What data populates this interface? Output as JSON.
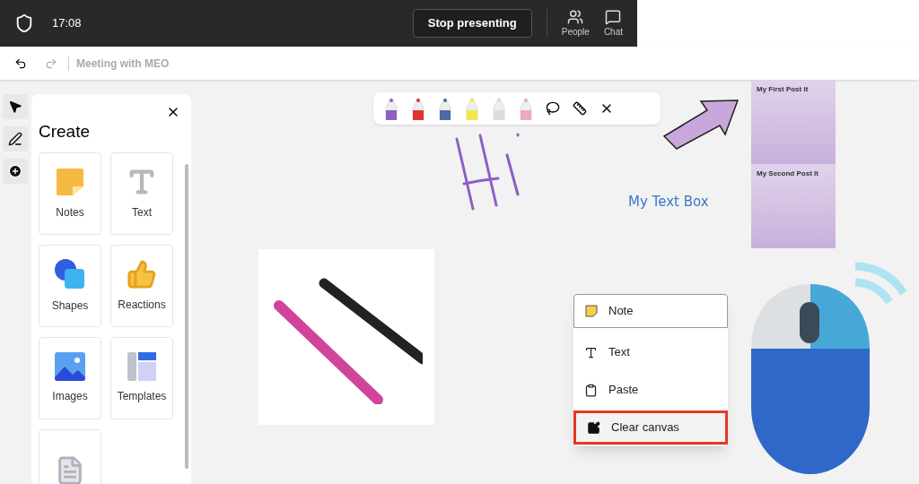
{
  "top_bar": {
    "time": "17:08",
    "stop_button": "Stop presenting",
    "actions": [
      {
        "kind": "people",
        "label": "People"
      },
      {
        "kind": "chat",
        "label": "Chat"
      }
    ]
  },
  "header": {
    "title": "Meeting with MEO"
  },
  "tool_strip": [
    {
      "kind": "select",
      "selected": false
    },
    {
      "kind": "pen",
      "selected": false
    },
    {
      "kind": "add",
      "selected": false
    }
  ],
  "create_panel": {
    "title": "Create",
    "tiles": [
      {
        "kind": "notes",
        "label": "Notes"
      },
      {
        "kind": "text",
        "label": "Text"
      },
      {
        "kind": "shapes",
        "label": "Shapes"
      },
      {
        "kind": "reactions",
        "label": "Reactions"
      },
      {
        "kind": "images",
        "label": "Images"
      },
      {
        "kind": "templates",
        "label": "Templates"
      },
      {
        "kind": "document"
      }
    ]
  },
  "ink_toolbar": {
    "pens": [
      {
        "color": "#8e5fc4"
      },
      {
        "color": "#e0352b"
      },
      {
        "color": "#4a6aa8"
      },
      {
        "color": "#f2e84a"
      },
      {
        "color": "#dcdcdc"
      },
      {
        "color": "#f1a8b8"
      }
    ]
  },
  "canvas": {
    "text_box": "My Text Box",
    "post_its": [
      "My First Post It",
      "My Second Post It"
    ]
  },
  "context_menu": [
    {
      "kind": "note",
      "label": "Note",
      "highlighted": false
    },
    {
      "kind": "text",
      "label": "Text",
      "highlighted": false
    },
    {
      "kind": "paste",
      "label": "Paste",
      "highlighted": false
    },
    {
      "kind": "clear",
      "label": "Clear canvas",
      "highlighted": true
    }
  ]
}
